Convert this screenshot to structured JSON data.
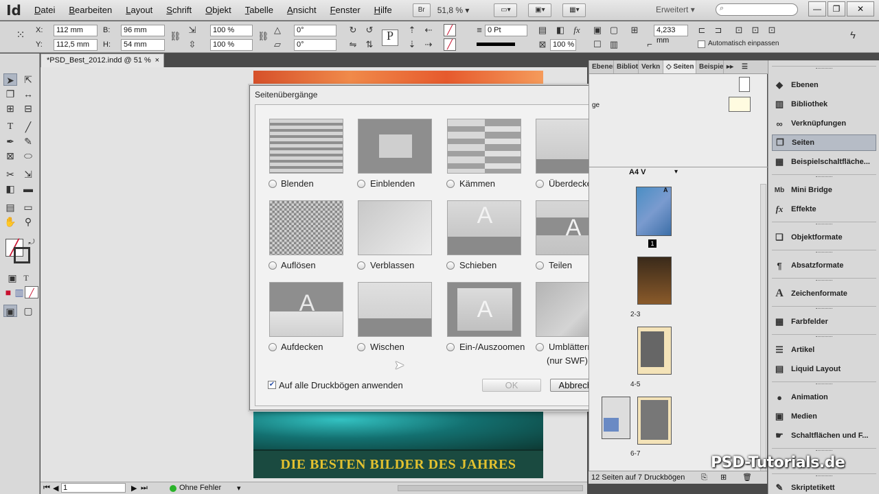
{
  "app": {
    "logo": "Id"
  },
  "menu": [
    "Datei",
    "Bearbeiten",
    "Layout",
    "Schrift",
    "Objekt",
    "Tabelle",
    "Ansicht",
    "Fenster",
    "Hilfe"
  ],
  "menubar": {
    "bridge_label": "Br",
    "zoom": "51,8 %",
    "workspace": "Erweitert",
    "workspace_arrow": "▾"
  },
  "control": {
    "x_label": "X:",
    "x_value": "112 mm",
    "y_label": "Y:",
    "y_value": "112,5 mm",
    "b_label": "B:",
    "b_value": "96 mm",
    "h_label": "H:",
    "h_value": "54 mm",
    "scale_x": "100 %",
    "scale_y": "100 %",
    "rotate": "0°",
    "shear": "0°",
    "stroke_weight": "0 Pt",
    "offset": "4,233 mm",
    "opacity": "100 %",
    "autofit_label": "Automatisch einpassen"
  },
  "document": {
    "tab_title": "*PSD_Best_2012.indd @ 51 %",
    "tab_close": "×",
    "banner_text": "DIE BESTEN BILDER DES JAHRES"
  },
  "statusbar": {
    "page": "1",
    "errors": "Ohne Fehler"
  },
  "dialog": {
    "title": "Seitenübergänge",
    "options": [
      {
        "label": "Blenden",
        "thumb": "blinds"
      },
      {
        "label": "Einblenden",
        "thumb": "box"
      },
      {
        "label": "Kämmen",
        "thumb": "comb"
      },
      {
        "label": "Überdecken",
        "thumb": "cover"
      },
      {
        "label": "Auflösen",
        "thumb": "dissolve"
      },
      {
        "label": "Verblassen",
        "thumb": "fade"
      },
      {
        "label": "Schieben",
        "thumb": "push"
      },
      {
        "label": "Teilen",
        "thumb": "split"
      },
      {
        "label": "Aufdecken",
        "thumb": "uncover"
      },
      {
        "label": "Wischen",
        "thumb": "wipe"
      },
      {
        "label": "Ein-/Auszoomen",
        "thumb": "zoom"
      },
      {
        "label": "Umblättern",
        "label2": "(nur SWF)",
        "thumb": "pageturn"
      }
    ],
    "thumb_letter": "A",
    "apply_all_label": "Auf alle Druckbögen anwenden",
    "apply_all_checked": true,
    "ok_label": "OK",
    "cancel_label": "Abbrechen"
  },
  "pages_panel": {
    "tabs": [
      "Ebenen",
      "Bibliot",
      "Verkn",
      "◇ Seiten",
      "Beispie"
    ],
    "active_tab": "◇ Seiten",
    "master_label": "A4 V",
    "master_text": "ge",
    "page_labels": [
      "1",
      "2-3",
      "4-5",
      "6-7"
    ],
    "master_letter": "A",
    "footer": "12 Seiten auf 7 Druckbögen"
  },
  "dock": {
    "items": [
      {
        "label": "Ebenen",
        "icon": "◆"
      },
      {
        "label": "Bibliothek",
        "icon": "▥"
      },
      {
        "label": "Verknüpfungen",
        "icon": "∞"
      },
      {
        "label": "Seiten",
        "icon": "❐",
        "active": true
      },
      {
        "label": "Beispielschaltfläche...",
        "icon": "▦"
      },
      {
        "label": "Mini Bridge",
        "icon": "Mb"
      },
      {
        "label": "Effekte",
        "icon": "fx"
      },
      {
        "label": "Objektformate",
        "icon": "❏"
      },
      {
        "label": "Absatzformate",
        "icon": "¶"
      },
      {
        "label": "Zeichenformate",
        "icon": "A"
      },
      {
        "label": "Farbfelder",
        "icon": "▦"
      },
      {
        "label": "Artikel",
        "icon": "☰"
      },
      {
        "label": "Liquid Layout",
        "icon": "▤"
      },
      {
        "label": "Animation",
        "icon": "●"
      },
      {
        "label": "Medien",
        "icon": "▣"
      },
      {
        "label": "Schaltflächen und F...",
        "icon": "☛"
      },
      {
        "label": "Skriptetikett",
        "icon": "✎"
      }
    ]
  },
  "watermark": "PSD-Tutorials.de"
}
